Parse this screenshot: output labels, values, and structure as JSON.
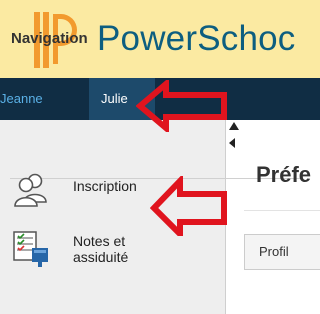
{
  "header": {
    "brand": "PowerSchoc",
    "logo_icon": "powerschool-logo-icon",
    "background": "#fbeaa2",
    "brand_color": "#0d5e80"
  },
  "student_tabs": [
    {
      "label": "Jeanne",
      "active": false
    },
    {
      "label": "Julie",
      "active": true
    }
  ],
  "sidebar": {
    "title": "Navigation",
    "items": [
      {
        "label": "Inscription",
        "icon": "users-icon"
      },
      {
        "label": "Notes et assiduité",
        "icon": "gradebook-icon"
      }
    ]
  },
  "main": {
    "page_title": "Préfe",
    "tabs": [
      {
        "label": "Profil"
      }
    ]
  },
  "colors": {
    "tabbar": "#102d44",
    "inactive_tab_text": "#5ab0e6",
    "annotation_arrow": "#e0141e"
  }
}
